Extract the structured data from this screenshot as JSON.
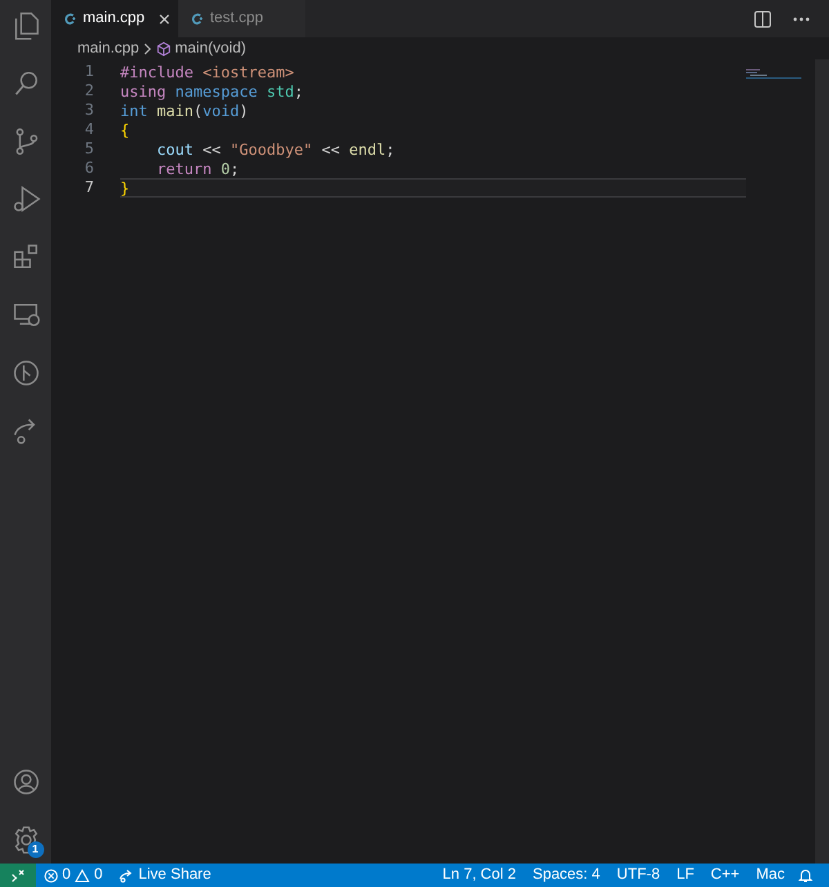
{
  "activity_bar": {
    "items": [
      {
        "kind": "files"
      },
      {
        "kind": "search"
      },
      {
        "kind": "source-control"
      },
      {
        "kind": "run"
      },
      {
        "kind": "extensions"
      },
      {
        "kind": "remote"
      },
      {
        "kind": "git"
      },
      {
        "kind": "share"
      }
    ],
    "accounts": {
      "kind": "account"
    },
    "settings": {
      "badge": "1"
    }
  },
  "tabs": [
    {
      "label": "main.cpp",
      "selected": true
    },
    {
      "label": "test.cpp",
      "selected": false
    }
  ],
  "breadcrumb": {
    "file": "main.cpp",
    "symbol": "main(void)"
  },
  "lines": [
    {
      "number": "1",
      "current": false,
      "tokens": [
        {
          "text": "#include",
          "kind": "keyword"
        },
        {
          "text": " <iostream>",
          "kind": "string"
        }
      ]
    },
    {
      "number": "2",
      "current": false,
      "tokens": [
        {
          "text": "using",
          "kind": "keyword"
        },
        {
          "text": " namespace",
          "kind": "type"
        },
        {
          "text": " std",
          "kind": "ns"
        },
        {
          "text": ";",
          "kind": "plain"
        }
      ]
    },
    {
      "number": "3",
      "current": false,
      "tokens": [
        {
          "text": "int",
          "kind": "type"
        },
        {
          "text": " main",
          "kind": "func"
        },
        {
          "text": "(",
          "kind": "plain"
        },
        {
          "text": "void",
          "kind": "type"
        },
        {
          "text": ")",
          "kind": "plain"
        }
      ]
    },
    {
      "number": "4",
      "current": false,
      "tokens": [
        {
          "text": "{",
          "kind": "bracket"
        }
      ]
    },
    {
      "number": "5",
      "current": false,
      "tokens": [
        {
          "text": "    cout",
          "kind": "variable"
        },
        {
          "text": " << ",
          "kind": "plain"
        },
        {
          "text": "\"Goodbye\"",
          "kind": "string"
        },
        {
          "text": " << ",
          "kind": "plain"
        },
        {
          "text": "endl",
          "kind": "func"
        },
        {
          "text": ";",
          "kind": "plain"
        }
      ]
    },
    {
      "number": "6",
      "current": false,
      "tokens": [
        {
          "text": "    return",
          "kind": "keyword"
        },
        {
          "text": " 0",
          "kind": "number"
        },
        {
          "text": ";",
          "kind": "plain"
        }
      ]
    },
    {
      "number": "7",
      "current": true,
      "tokens": [
        {
          "text": "}",
          "kind": "bracket"
        }
      ]
    }
  ],
  "status_bar": {
    "errors": "0",
    "warnings": "0",
    "live_share": "Live Share",
    "right": [
      "Ln 7, Col 2",
      "Spaces: 4",
      "UTF-8",
      "LF",
      "C++",
      "Mac"
    ]
  }
}
